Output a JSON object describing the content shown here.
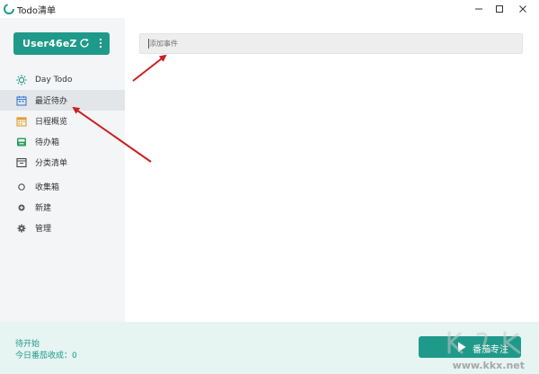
{
  "window": {
    "title": "Todo清单"
  },
  "sidebar": {
    "user": {
      "name": "User46eZ"
    },
    "nav": [
      {
        "label": "Day Todo",
        "icon": "sun-icon"
      },
      {
        "label": "最近待办",
        "icon": "calendar-icon",
        "active": true
      },
      {
        "label": "日程概览",
        "icon": "calendar-grid-icon"
      },
      {
        "label": "待办箱",
        "icon": "inbox-icon"
      },
      {
        "label": "分类清单",
        "icon": "category-list-icon"
      },
      {
        "label": "收集箱",
        "icon": "circle-icon"
      },
      {
        "label": "新建",
        "icon": "plus-icon"
      },
      {
        "label": "管理",
        "icon": "gear-icon"
      }
    ]
  },
  "main": {
    "add_input": {
      "placeholder": "添加事件"
    }
  },
  "footer": {
    "status": "待开始",
    "stats": "今日番茄收成：0",
    "pomodoro_button": "番茄专注"
  },
  "watermark": {
    "url": "www.kkx.net"
  },
  "colors": {
    "accent": "#1f9a8a",
    "sidebar_bg": "#f3f5f6",
    "footer_bg": "#e6f4f2",
    "annotation": "#cc1f1f"
  }
}
